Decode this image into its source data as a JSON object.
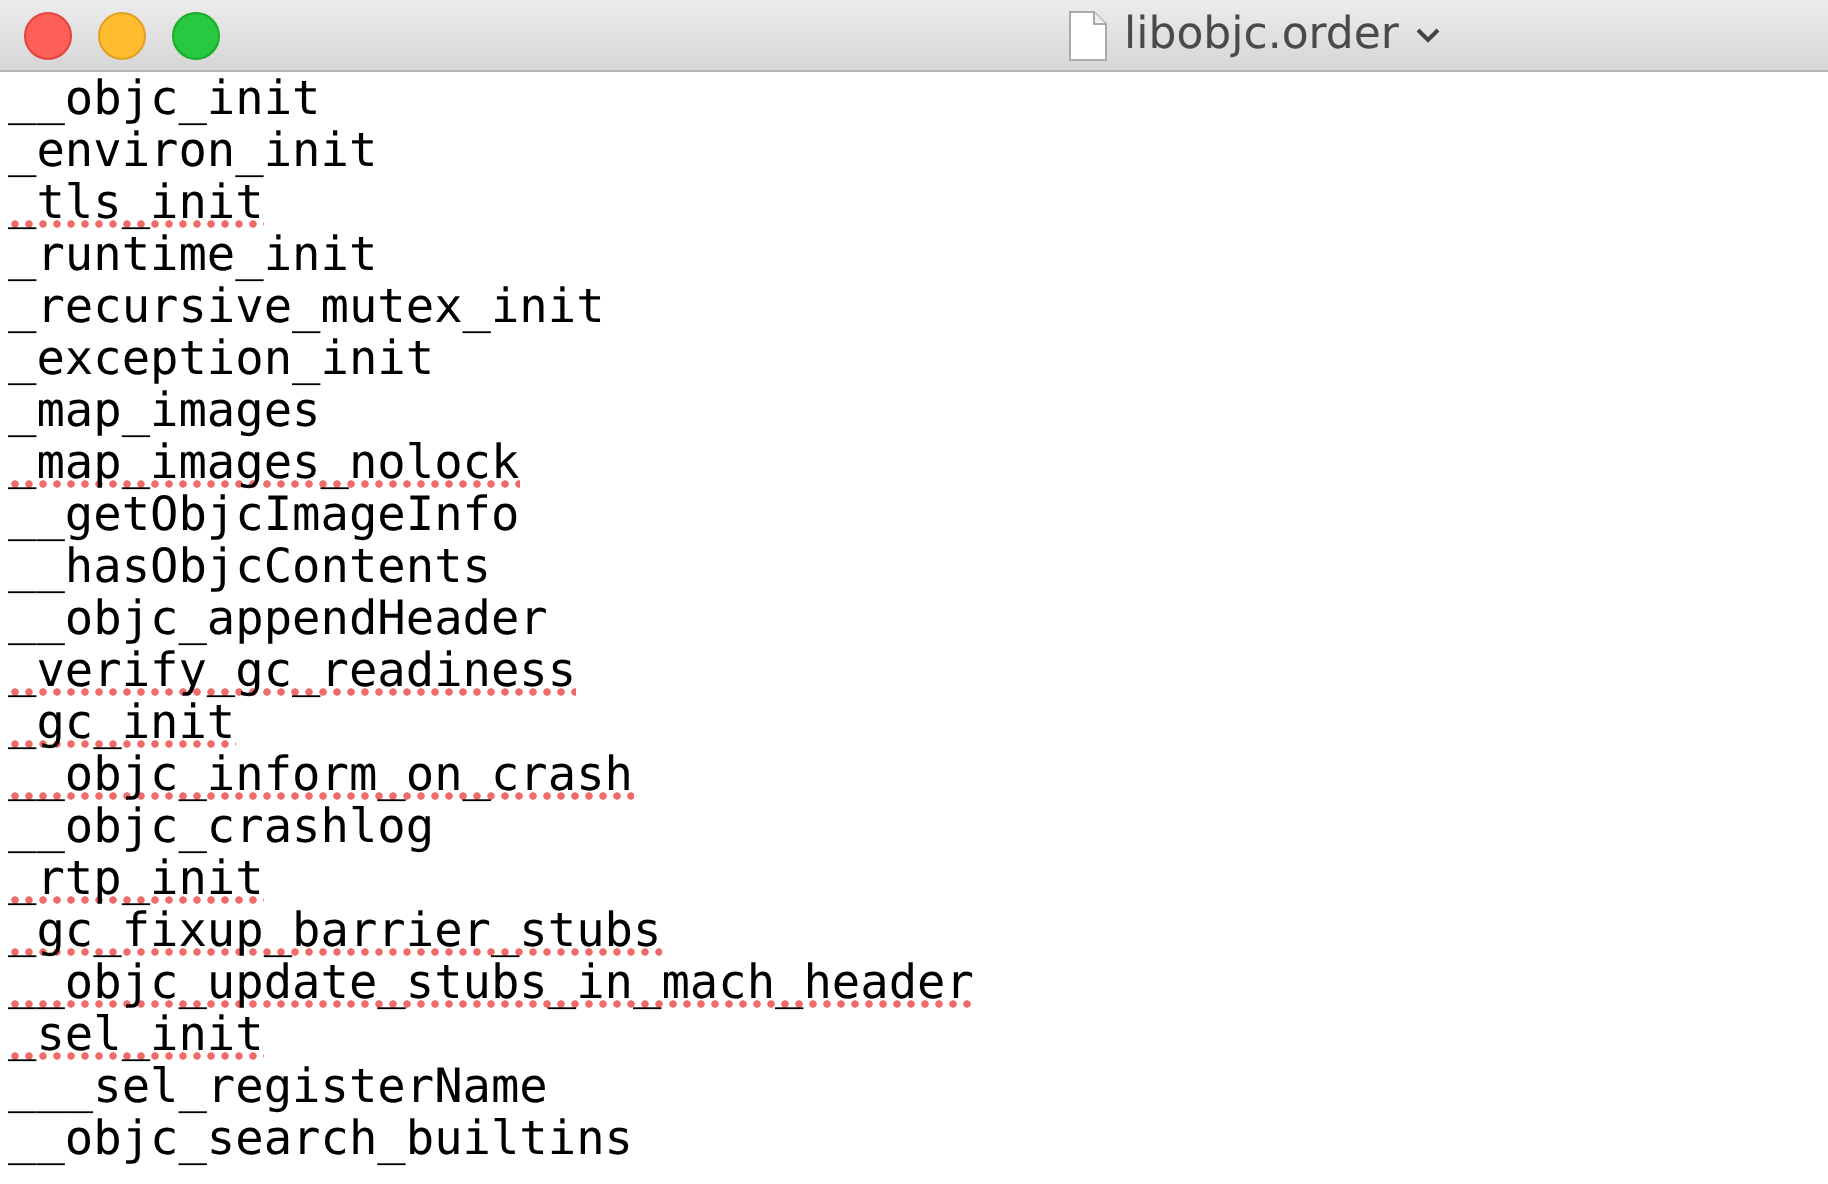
{
  "window": {
    "title": "libobjc.order"
  },
  "lines": [
    {
      "text": "__objc_init",
      "misspelled": false
    },
    {
      "text": "_environ_init",
      "misspelled": false
    },
    {
      "text": "_tls_init",
      "misspelled": true
    },
    {
      "text": "_runtime_init",
      "misspelled": false
    },
    {
      "text": "_recursive_mutex_init",
      "misspelled": false
    },
    {
      "text": "_exception_init",
      "misspelled": false
    },
    {
      "text": "_map_images",
      "misspelled": false
    },
    {
      "text": "_map_images_nolock",
      "misspelled": true
    },
    {
      "text": "__getObjcImageInfo",
      "misspelled": false
    },
    {
      "text": "__hasObjcContents",
      "misspelled": false
    },
    {
      "text": "__objc_appendHeader",
      "misspelled": false
    },
    {
      "text": "_verify_gc_readiness",
      "misspelled": true
    },
    {
      "text": "_gc_init",
      "misspelled": true
    },
    {
      "text": "__objc_inform_on_crash",
      "misspelled": true
    },
    {
      "text": "__objc_crashlog",
      "misspelled": false
    },
    {
      "text": "_rtp_init",
      "misspelled": true
    },
    {
      "text": "_gc_fixup_barrier_stubs",
      "misspelled": true
    },
    {
      "text": "__objc_update_stubs_in_mach_header",
      "misspelled": true
    },
    {
      "text": "_sel_init",
      "misspelled": true
    },
    {
      "text": "___sel_registerName",
      "misspelled": false
    },
    {
      "text": "__objc_search_builtins",
      "misspelled": false
    }
  ]
}
